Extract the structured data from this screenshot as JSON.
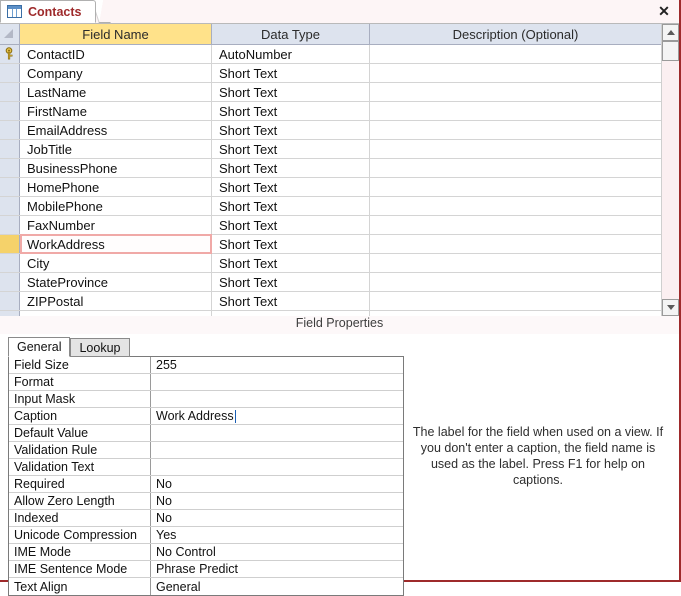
{
  "window": {
    "close_label": "✕",
    "accent_border": "#9e2a2b"
  },
  "tab": {
    "icon": "table-grid-icon",
    "label": "Contacts"
  },
  "grid": {
    "headers": {
      "selector": "",
      "field_name": "Field Name",
      "data_type": "Data Type",
      "description": "Description (Optional)"
    },
    "header_highlight_color": "#ffe28a",
    "selected_row_border_color": "#f0a9a7",
    "selected_row_marker_color": "#f5d26a",
    "rows": [
      {
        "field_name": "ContactID",
        "data_type": "AutoNumber",
        "description": "",
        "primary_key": true,
        "selected": false
      },
      {
        "field_name": "Company",
        "data_type": "Short Text",
        "description": "",
        "primary_key": false,
        "selected": false
      },
      {
        "field_name": "LastName",
        "data_type": "Short Text",
        "description": "",
        "primary_key": false,
        "selected": false
      },
      {
        "field_name": "FirstName",
        "data_type": "Short Text",
        "description": "",
        "primary_key": false,
        "selected": false
      },
      {
        "field_name": "EmailAddress",
        "data_type": "Short Text",
        "description": "",
        "primary_key": false,
        "selected": false
      },
      {
        "field_name": "JobTitle",
        "data_type": "Short Text",
        "description": "",
        "primary_key": false,
        "selected": false
      },
      {
        "field_name": "BusinessPhone",
        "data_type": "Short Text",
        "description": "",
        "primary_key": false,
        "selected": false
      },
      {
        "field_name": "HomePhone",
        "data_type": "Short Text",
        "description": "",
        "primary_key": false,
        "selected": false
      },
      {
        "field_name": "MobilePhone",
        "data_type": "Short Text",
        "description": "",
        "primary_key": false,
        "selected": false
      },
      {
        "field_name": "FaxNumber",
        "data_type": "Short Text",
        "description": "",
        "primary_key": false,
        "selected": false
      },
      {
        "field_name": "WorkAddress",
        "data_type": "Short Text",
        "description": "",
        "primary_key": false,
        "selected": true
      },
      {
        "field_name": "City",
        "data_type": "Short Text",
        "description": "",
        "primary_key": false,
        "selected": false
      },
      {
        "field_name": "StateProvince",
        "data_type": "Short Text",
        "description": "",
        "primary_key": false,
        "selected": false
      },
      {
        "field_name": "ZIPPostal",
        "data_type": "Short Text",
        "description": "",
        "primary_key": false,
        "selected": false
      },
      {
        "field_name": "",
        "data_type": "",
        "description": "",
        "primary_key": false,
        "selected": false
      }
    ],
    "scrollbar": {
      "up_arrow": "scroll-up-icon",
      "down_arrow": "scroll-down-icon"
    }
  },
  "divider": {
    "label": "Field Properties"
  },
  "properties": {
    "tabs": [
      {
        "label": "General",
        "active": true
      },
      {
        "label": "Lookup",
        "active": false
      }
    ],
    "rows": [
      {
        "name": "Field Size",
        "value": "255"
      },
      {
        "name": "Format",
        "value": ""
      },
      {
        "name": "Input Mask",
        "value": ""
      },
      {
        "name": "Caption",
        "value": "Work Address",
        "has_caret": true
      },
      {
        "name": "Default Value",
        "value": ""
      },
      {
        "name": "Validation Rule",
        "value": ""
      },
      {
        "name": "Validation Text",
        "value": ""
      },
      {
        "name": "Required",
        "value": "No"
      },
      {
        "name": "Allow Zero Length",
        "value": "No"
      },
      {
        "name": "Indexed",
        "value": "No"
      },
      {
        "name": "Unicode Compression",
        "value": "Yes"
      },
      {
        "name": "IME Mode",
        "value": "No Control"
      },
      {
        "name": "IME Sentence Mode",
        "value": "Phrase Predict"
      },
      {
        "name": "Text Align",
        "value": "General"
      }
    ]
  },
  "help": {
    "text": "The label for the field when used on a view. If you don't enter a caption, the field name is used as the label. Press F1 for help on captions."
  }
}
